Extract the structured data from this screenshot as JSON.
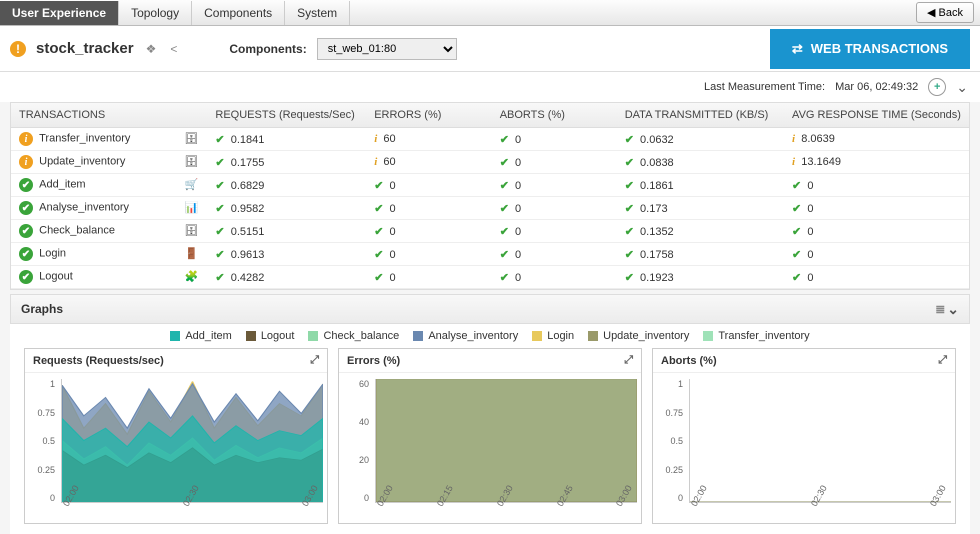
{
  "nav_tabs": [
    "User Experience",
    "Topology",
    "Components",
    "System"
  ],
  "active_tab": "User Experience",
  "back_label": "Back",
  "page_title": "stock_tracker",
  "components_label": "Components:",
  "components_selected": "st_web_01:80",
  "web_trans_label": "WEB TRANSACTIONS",
  "last_meas_label": "Last Measurement Time:",
  "last_meas_value": "Mar 06, 02:49:32",
  "columns": [
    "TRANSACTIONS",
    "REQUESTS (Requests/Sec)",
    "ERRORS (%)",
    "ABORTS (%)",
    "DATA TRANSMITTED (KB/S)",
    "AVG RESPONSE TIME (Seconds)"
  ],
  "rows": [
    {
      "status": "info",
      "name": "Transfer_inventory",
      "icon": "db",
      "req": "0.1841",
      "req_s": "ok",
      "err": "60",
      "err_s": "warn",
      "ab": "0",
      "ab_s": "ok",
      "data": "0.0632",
      "data_s": "ok",
      "resp": "8.0639",
      "resp_s": "warn"
    },
    {
      "status": "info",
      "name": "Update_inventory",
      "icon": "db-refresh",
      "req": "0.1755",
      "req_s": "ok",
      "err": "60",
      "err_s": "warn",
      "ab": "0",
      "ab_s": "ok",
      "data": "0.0838",
      "data_s": "ok",
      "resp": "13.1649",
      "resp_s": "warn"
    },
    {
      "status": "ok",
      "name": "Add_item",
      "icon": "cart",
      "req": "0.6829",
      "req_s": "ok",
      "err": "0",
      "err_s": "ok",
      "ab": "0",
      "ab_s": "ok",
      "data": "0.1861",
      "data_s": "ok",
      "resp": "0",
      "resp_s": "ok"
    },
    {
      "status": "ok",
      "name": "Analyse_inventory",
      "icon": "equalizer",
      "req": "0.9582",
      "req_s": "ok",
      "err": "0",
      "err_s": "ok",
      "ab": "0",
      "ab_s": "ok",
      "data": "0.173",
      "data_s": "ok",
      "resp": "0",
      "resp_s": "ok"
    },
    {
      "status": "ok",
      "name": "Check_balance",
      "icon": "db",
      "req": "0.5151",
      "req_s": "ok",
      "err": "0",
      "err_s": "ok",
      "ab": "0",
      "ab_s": "ok",
      "data": "0.1352",
      "data_s": "ok",
      "resp": "0",
      "resp_s": "ok"
    },
    {
      "status": "ok",
      "name": "Login",
      "icon": "door",
      "req": "0.9613",
      "req_s": "ok",
      "err": "0",
      "err_s": "ok",
      "ab": "0",
      "ab_s": "ok",
      "data": "0.1758",
      "data_s": "ok",
      "resp": "0",
      "resp_s": "ok"
    },
    {
      "status": "ok",
      "name": "Logout",
      "icon": "puzzle",
      "req": "0.4282",
      "req_s": "ok",
      "err": "0",
      "err_s": "ok",
      "ab": "0",
      "ab_s": "ok",
      "data": "0.1923",
      "data_s": "ok",
      "resp": "0",
      "resp_s": "ok"
    }
  ],
  "graphs_label": "Graphs",
  "legend": [
    {
      "label": "Add_item",
      "color": "#1fb5ac"
    },
    {
      "label": "Logout",
      "color": "#6b5a3a"
    },
    {
      "label": "Check_balance",
      "color": "#8fd9a8"
    },
    {
      "label": "Analyse_inventory",
      "color": "#6a88b0"
    },
    {
      "label": "Login",
      "color": "#e8c95c"
    },
    {
      "label": "Update_inventory",
      "color": "#9a9a6a"
    },
    {
      "label": "Transfer_inventory",
      "color": "#9fe2b8"
    }
  ],
  "charts": [
    {
      "title": "Requests (Requests/sec)",
      "yticks": [
        "1",
        "0.75",
        "0.5",
        "0.25",
        "0"
      ],
      "xticks": [
        "02:00",
        "02:30",
        "03:00"
      ]
    },
    {
      "title": "Errors (%)",
      "yticks": [
        "60",
        "40",
        "20",
        "0"
      ],
      "xticks": [
        "02:00",
        "02:15",
        "02:30",
        "02:45",
        "03:00"
      ]
    },
    {
      "title": "Aborts (%)",
      "yticks": [
        "1",
        "0.75",
        "0.5",
        "0.25",
        "0"
      ],
      "xticks": [
        "02:00",
        "02:30",
        "03:00"
      ]
    }
  ],
  "chart_data": [
    {
      "type": "area",
      "title": "Requests (Requests/sec)",
      "xlabel": "",
      "ylabel": "",
      "ylim": [
        0,
        1
      ],
      "x": [
        "02:00",
        "02:05",
        "02:10",
        "02:15",
        "02:20",
        "02:25",
        "02:30",
        "02:35",
        "02:40",
        "02:45",
        "02:50",
        "02:55",
        "03:00"
      ],
      "series": [
        {
          "name": "Transfer_inventory",
          "values": [
            0.18,
            0.2,
            0.17,
            0.19,
            0.16,
            0.18,
            0.2,
            0.17,
            0.19,
            0.18,
            0.17,
            0.19,
            0.18
          ]
        },
        {
          "name": "Update_inventory",
          "values": [
            0.17,
            0.16,
            0.18,
            0.17,
            0.18,
            0.16,
            0.17,
            0.18,
            0.17,
            0.18,
            0.17,
            0.18,
            0.18
          ]
        },
        {
          "name": "Login",
          "values": [
            0.95,
            0.6,
            0.8,
            0.55,
            0.9,
            0.65,
            0.98,
            0.6,
            0.85,
            0.62,
            0.8,
            0.7,
            0.96
          ]
        },
        {
          "name": "Analyse_inventory",
          "values": [
            0.95,
            0.7,
            0.85,
            0.6,
            0.92,
            0.68,
            0.96,
            0.65,
            0.88,
            0.66,
            0.9,
            0.72,
            0.96
          ]
        },
        {
          "name": "Check_balance",
          "values": [
            0.5,
            0.35,
            0.45,
            0.3,
            0.48,
            0.38,
            0.52,
            0.34,
            0.46,
            0.36,
            0.44,
            0.4,
            0.52
          ]
        },
        {
          "name": "Logout",
          "values": [
            0.42,
            0.3,
            0.38,
            0.28,
            0.4,
            0.32,
            0.44,
            0.3,
            0.38,
            0.32,
            0.36,
            0.34,
            0.43
          ]
        },
        {
          "name": "Add_item",
          "values": [
            0.68,
            0.5,
            0.6,
            0.45,
            0.65,
            0.52,
            0.7,
            0.48,
            0.62,
            0.5,
            0.58,
            0.54,
            0.68
          ]
        }
      ]
    },
    {
      "type": "area",
      "title": "Errors (%)",
      "xlabel": "",
      "ylabel": "",
      "ylim": [
        0,
        60
      ],
      "x": [
        "02:00",
        "02:15",
        "02:30",
        "02:45",
        "03:00"
      ],
      "series": [
        {
          "name": "Transfer_inventory",
          "values": [
            60,
            60,
            60,
            60,
            60
          ]
        },
        {
          "name": "Update_inventory",
          "values": [
            60,
            60,
            60,
            60,
            60
          ]
        },
        {
          "name": "Add_item",
          "values": [
            0,
            0,
            0,
            0,
            0
          ]
        },
        {
          "name": "Analyse_inventory",
          "values": [
            0,
            0,
            0,
            0,
            0
          ]
        },
        {
          "name": "Check_balance",
          "values": [
            0,
            0,
            0,
            0,
            0
          ]
        },
        {
          "name": "Login",
          "values": [
            0,
            0,
            0,
            0,
            0
          ]
        },
        {
          "name": "Logout",
          "values": [
            0,
            0,
            0,
            0,
            0
          ]
        }
      ]
    },
    {
      "type": "area",
      "title": "Aborts (%)",
      "xlabel": "",
      "ylabel": "",
      "ylim": [
        0,
        1
      ],
      "x": [
        "02:00",
        "02:30",
        "03:00"
      ],
      "series": [
        {
          "name": "Transfer_inventory",
          "values": [
            0,
            0,
            0
          ]
        },
        {
          "name": "Update_inventory",
          "values": [
            0,
            0,
            0
          ]
        },
        {
          "name": "Add_item",
          "values": [
            0,
            0,
            0
          ]
        },
        {
          "name": "Analyse_inventory",
          "values": [
            0,
            0,
            0
          ]
        },
        {
          "name": "Check_balance",
          "values": [
            0,
            0,
            0
          ]
        },
        {
          "name": "Login",
          "values": [
            0,
            0,
            0
          ]
        },
        {
          "name": "Logout",
          "values": [
            0,
            0,
            0
          ]
        }
      ]
    }
  ],
  "icon_map": {
    "db": "🗄",
    "db-refresh": "🗄",
    "cart": "🛒",
    "equalizer": "📊",
    "door": "🚪",
    "puzzle": "🧩"
  },
  "colors": {
    "accent": "#1a94cf",
    "ok": "#3aa43a",
    "warn": "#f0a020"
  }
}
